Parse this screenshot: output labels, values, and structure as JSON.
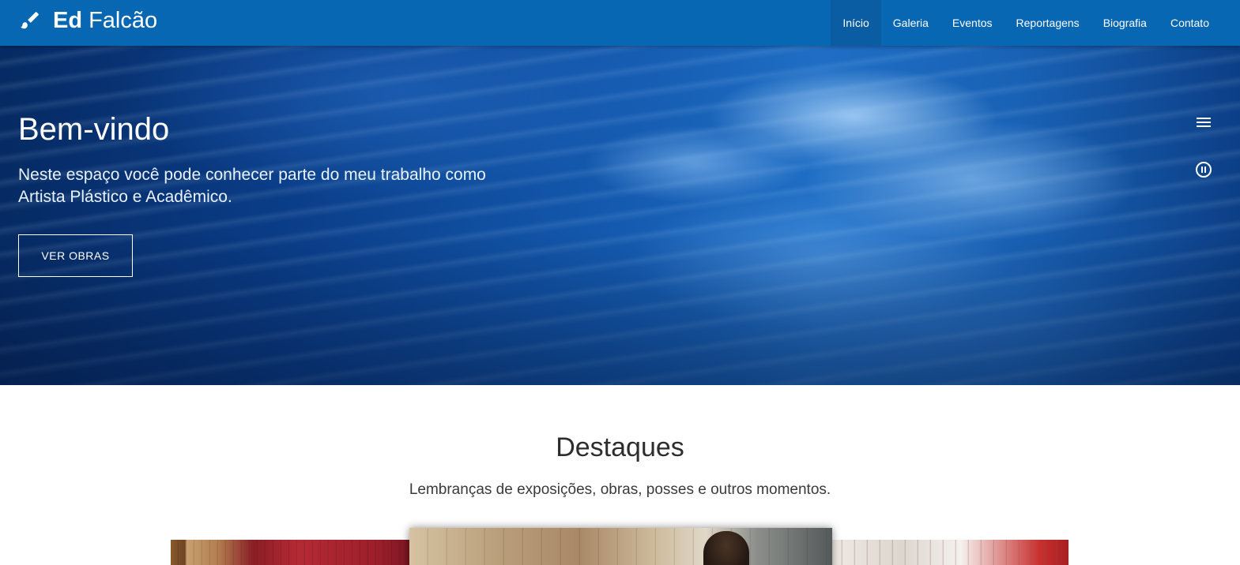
{
  "navbar": {
    "brand": {
      "bold": "Ed",
      "light": "Falcão",
      "icon": "paintbrush-icon"
    },
    "items": [
      {
        "label": "Início",
        "active": true
      },
      {
        "label": "Galeria",
        "active": false
      },
      {
        "label": "Eventos",
        "active": false
      },
      {
        "label": "Reportagens",
        "active": false
      },
      {
        "label": "Biografia",
        "active": false
      },
      {
        "label": "Contato",
        "active": false
      }
    ],
    "colors": {
      "background": "#0867b3",
      "active": "#0a5da2"
    }
  },
  "hero": {
    "title": "Bem-vindo",
    "subtitle": "Neste espaço você pode conhecer parte do meu trabalho como Artista Plástico e Acadêmico.",
    "button_label": "VER OBRAS",
    "icons": [
      "menu-icon",
      "pause-icon"
    ]
  },
  "highlights": {
    "title": "Destaques",
    "subtitle": "Lembranças de exposições, obras, posses e outros momentos."
  }
}
